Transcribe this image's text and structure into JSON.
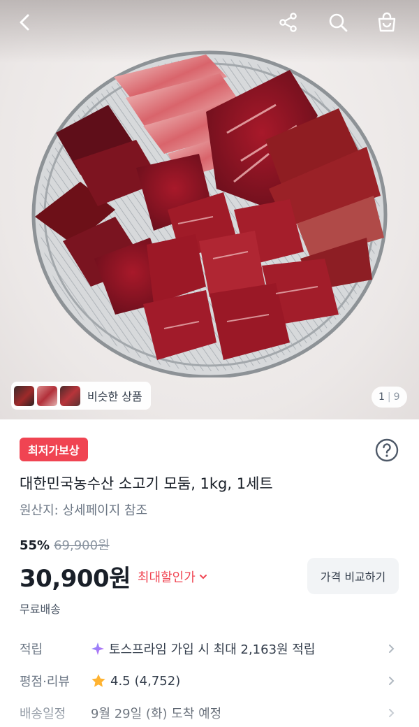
{
  "top_bar": {
    "back_icon": "chevron-left-icon",
    "share_icon": "share-icon",
    "search_icon": "search-icon",
    "cart_icon": "shopping-bag-icon"
  },
  "gallery": {
    "similar_label": "비슷한 상품",
    "current_page": "1",
    "separator": "|",
    "total_pages": "9"
  },
  "product": {
    "badge": "최저가보상",
    "title": "대한민국농수산 소고기 모둠, 1kg, 1세트",
    "origin": "원산지: 상세페이지 참조",
    "discount_rate": "55%",
    "original_price": "69,900원",
    "price": "30,900원",
    "max_discount_label": "최대할인가",
    "compare_button": "가격 비교하기",
    "shipping": "무료배송"
  },
  "details": [
    {
      "label": "적립",
      "value": "토스프라임 가입 시 최대 2,163원 적립",
      "icon": "sparkle-icon"
    },
    {
      "label": "평점·리뷰",
      "rating": "4.5",
      "reviews": "(4,752)",
      "icon": "star-icon"
    },
    {
      "label": "배송일정",
      "value": "9월 29일 (화) 도착 예정"
    }
  ],
  "colors": {
    "accent_red": "#f04452",
    "text_primary": "#191f28",
    "text_secondary": "#6b7684",
    "button_bg": "#f2f4f6",
    "star": "#ffb331"
  }
}
